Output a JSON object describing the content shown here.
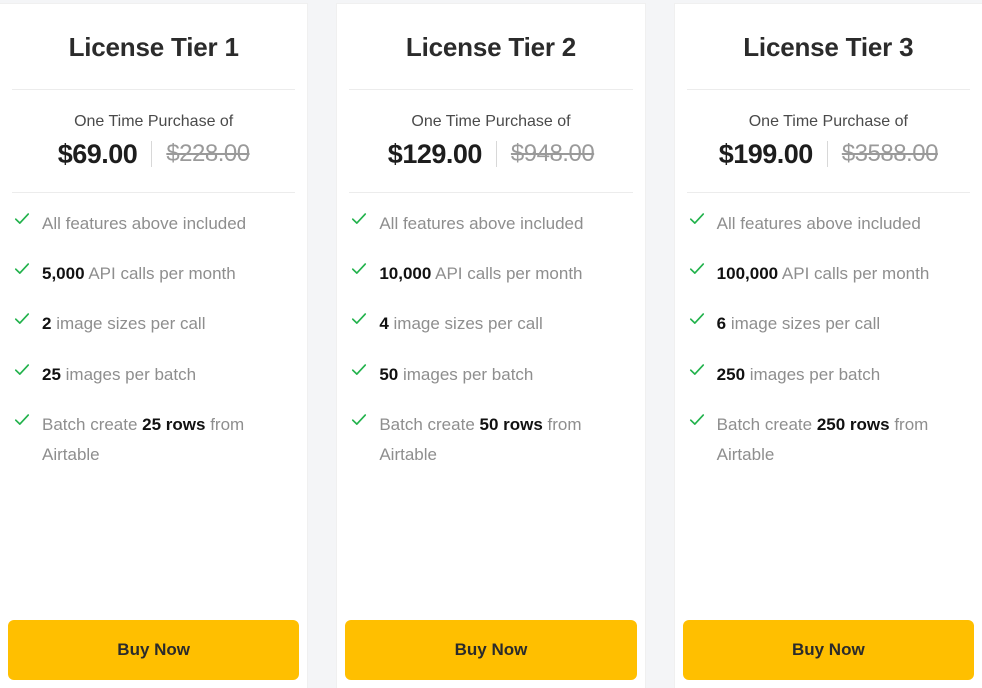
{
  "page": {
    "background_color": "#f4f5f7",
    "accent_color": "#ffbf00",
    "check_color": "#22b24c"
  },
  "tiers": [
    {
      "title": "License Tier 1",
      "price_caption": "One Time Purchase of",
      "price_now": "$69.00",
      "price_was": "$228.00",
      "buy_label": "Buy Now",
      "features": [
        {
          "prefix": "",
          "bold": "",
          "suffix": "All features above included"
        },
        {
          "prefix": "",
          "bold": "5,000",
          "suffix": " API calls per month"
        },
        {
          "prefix": "",
          "bold": "2",
          "suffix": " image sizes per call"
        },
        {
          "prefix": "",
          "bold": "25",
          "suffix": " images per batch"
        },
        {
          "prefix": "Batch create ",
          "bold": "25 rows",
          "suffix": " from Airtable"
        }
      ]
    },
    {
      "title": "License Tier 2",
      "price_caption": "One Time Purchase of",
      "price_now": "$129.00",
      "price_was": "$948.00",
      "buy_label": "Buy Now",
      "features": [
        {
          "prefix": "",
          "bold": "",
          "suffix": "All features above included"
        },
        {
          "prefix": "",
          "bold": "10,000",
          "suffix": " API calls per month"
        },
        {
          "prefix": "",
          "bold": "4",
          "suffix": " image sizes per call"
        },
        {
          "prefix": "",
          "bold": "50",
          "suffix": " images per batch"
        },
        {
          "prefix": "Batch create ",
          "bold": "50 rows",
          "suffix": " from Airtable"
        }
      ]
    },
    {
      "title": "License Tier 3",
      "price_caption": "One Time Purchase of",
      "price_now": "$199.00",
      "price_was": "$3588.00",
      "buy_label": "Buy Now",
      "features": [
        {
          "prefix": "",
          "bold": "",
          "suffix": "All features above included"
        },
        {
          "prefix": "",
          "bold": "100,000",
          "suffix": " API calls per month"
        },
        {
          "prefix": "",
          "bold": "6",
          "suffix": " image sizes per call"
        },
        {
          "prefix": "",
          "bold": "250",
          "suffix": " images per batch"
        },
        {
          "prefix": "Batch create ",
          "bold": "250 rows",
          "suffix": " from Airtable"
        }
      ]
    }
  ]
}
